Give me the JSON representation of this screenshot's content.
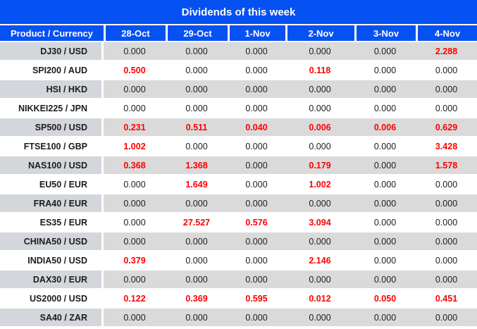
{
  "title": "Dividends of this week",
  "colors": {
    "header_blue": "#0551f2",
    "highlight_red": "#fe0000",
    "row_gray": "#dadada",
    "product_column_gray": "#d3d6db",
    "separator_white": "#ffffff",
    "value_black": "#1c1c1c"
  },
  "table": {
    "columns": [
      "Product / Currency",
      "28-Oct",
      "29-Oct",
      "1-Nov",
      "2-Nov",
      "3-Nov",
      "4-Nov"
    ],
    "rows": [
      {
        "product": "DJ30 / USD",
        "values": [
          "0.000",
          "0.000",
          "0.000",
          "0.000",
          "0.000",
          "2.288"
        ]
      },
      {
        "product": "SPI200 / AUD",
        "values": [
          "0.500",
          "0.000",
          "0.000",
          "0.118",
          "0.000",
          "0.000"
        ]
      },
      {
        "product": "HSI / HKD",
        "values": [
          "0.000",
          "0.000",
          "0.000",
          "0.000",
          "0.000",
          "0.000"
        ]
      },
      {
        "product": "NIKKEI225 / JPN",
        "values": [
          "0.000",
          "0.000",
          "0.000",
          "0.000",
          "0.000",
          "0.000"
        ]
      },
      {
        "product": "SP500 / USD",
        "values": [
          "0.231",
          "0.511",
          "0.040",
          "0.006",
          "0.006",
          "0.629"
        ]
      },
      {
        "product": "FTSE100 / GBP",
        "values": [
          "1.002",
          "0.000",
          "0.000",
          "0.000",
          "0.000",
          "3.428"
        ]
      },
      {
        "product": "NAS100 / USD",
        "values": [
          "0.368",
          "1.368",
          "0.000",
          "0.179",
          "0.000",
          "1.578"
        ]
      },
      {
        "product": "EU50 / EUR",
        "values": [
          "0.000",
          "1.649",
          "0.000",
          "1.002",
          "0.000",
          "0.000"
        ]
      },
      {
        "product": "FRA40 / EUR",
        "values": [
          "0.000",
          "0.000",
          "0.000",
          "0.000",
          "0.000",
          "0.000"
        ]
      },
      {
        "product": "ES35 / EUR",
        "values": [
          "0.000",
          "27.527",
          "0.576",
          "3.094",
          "0.000",
          "0.000"
        ]
      },
      {
        "product": "CHINA50 / USD",
        "values": [
          "0.000",
          "0.000",
          "0.000",
          "0.000",
          "0.000",
          "0.000"
        ]
      },
      {
        "product": "INDIA50 / USD",
        "values": [
          "0.379",
          "0.000",
          "0.000",
          "2.146",
          "0.000",
          "0.000"
        ]
      },
      {
        "product": "DAX30 / EUR",
        "values": [
          "0.000",
          "0.000",
          "0.000",
          "0.000",
          "0.000",
          "0.000"
        ]
      },
      {
        "product": "US2000 / USD",
        "values": [
          "0.122",
          "0.369",
          "0.595",
          "0.012",
          "0.050",
          "0.451"
        ]
      },
      {
        "product": "SA40 / ZAR",
        "values": [
          "0.000",
          "0.000",
          "0.000",
          "0.000",
          "0.000",
          "0.000"
        ]
      }
    ]
  }
}
